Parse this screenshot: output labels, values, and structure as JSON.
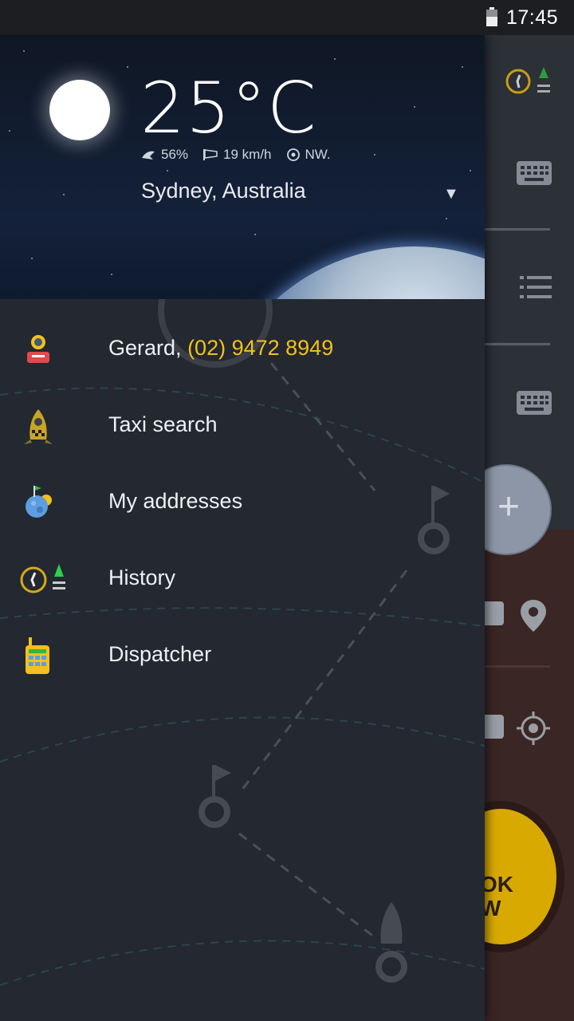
{
  "status_bar": {
    "time": "17:45"
  },
  "weather": {
    "temperature": "25°C",
    "humidity": "56%",
    "wind_speed": "19 km/h",
    "wind_direction": "NW.",
    "location": "Sydney, Australia"
  },
  "menu": {
    "user": {
      "name": "Gerard,",
      "phone": "(02) 9472 8949"
    },
    "items": [
      {
        "label": "Taxi search",
        "icon": "rocket-taxi-icon"
      },
      {
        "label": "My addresses",
        "icon": "planet-flag-icon"
      },
      {
        "label": "History",
        "icon": "clock-rocket-icon"
      },
      {
        "label": "Dispatcher",
        "icon": "walkie-talkie-icon"
      }
    ]
  },
  "background_app": {
    "book_button_text": [
      "OK",
      "W"
    ],
    "icons": [
      "history-icon",
      "keyboard-icon",
      "list-icon",
      "keyboard-icon",
      "plus-icon",
      "keyboard-icon",
      "location-pin-icon",
      "keyboard-icon",
      "gps-target-icon"
    ]
  },
  "colors": {
    "accent": "#f3c11a",
    "drawer_bg": "#232831"
  }
}
